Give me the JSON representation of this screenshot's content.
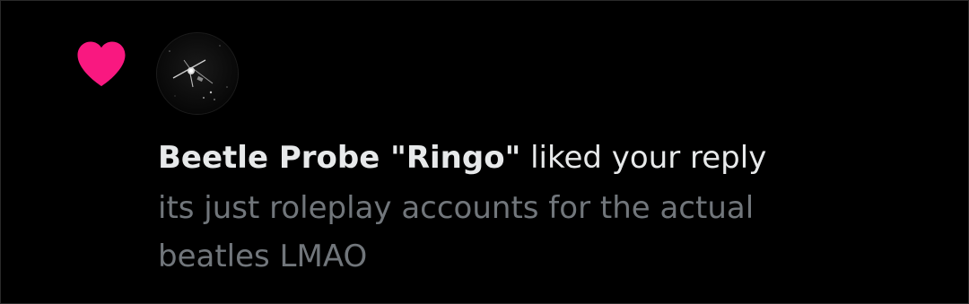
{
  "notification": {
    "type_icon": "heart-icon",
    "type_icon_color": "#f91880",
    "avatar_icon": "satellite-probe-avatar",
    "user_name": "Beetle Probe \"Ringo\"",
    "action_text": "liked your reply",
    "reply_text": "its just roleplay accounts for the actual beatles LMAO"
  },
  "colors": {
    "background": "#000000",
    "primary_text": "#e7e9ea",
    "secondary_text": "#71767b",
    "like": "#f91880"
  }
}
